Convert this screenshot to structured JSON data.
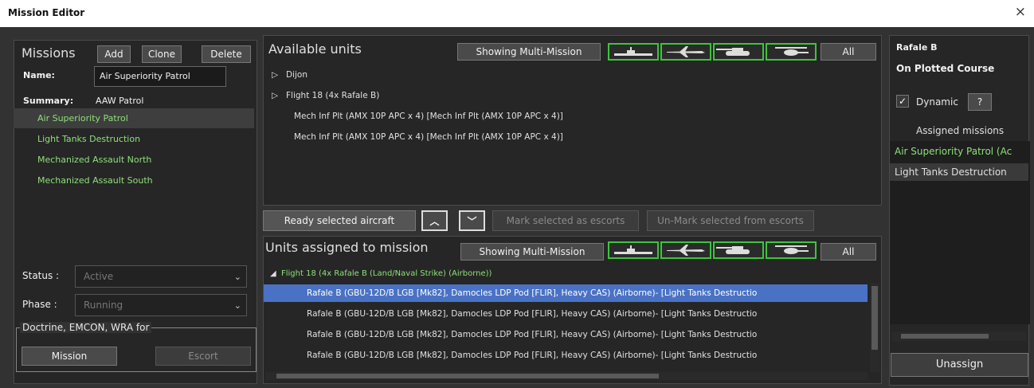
{
  "window": {
    "title": "Mission Editor",
    "close_glyph": "×"
  },
  "missions": {
    "header": "Missions",
    "add_label": "Add",
    "clone_label": "Clone",
    "delete_label": "Delete",
    "name_label": "Name:",
    "name_value": "Air Superiority Patrol",
    "summary_label": "Summary:",
    "summary_value": "AAW Patrol",
    "items": [
      {
        "label": "Air Superiority Patrol"
      },
      {
        "label": "Light Tanks Destruction"
      },
      {
        "label": "Mechanized Assault North"
      },
      {
        "label": "Mechanized Assault South"
      }
    ],
    "status_label": "Status :",
    "status_value": "Active",
    "phase_label": "Phase :",
    "phase_value": "Running",
    "doctrine_label": "Doctrine, EMCON, WRA for",
    "mission_btn": "Mission",
    "escort_btn": "Escort"
  },
  "available": {
    "header": "Available units",
    "filter_label": "Showing Multi-Mission",
    "all_label": "All",
    "rows": [
      {
        "expander": "▷",
        "text": "Dijon"
      },
      {
        "expander": "▷",
        "text": "Flight 18 (4x Rafale B)"
      },
      {
        "expander": "",
        "text": "Mech Inf Plt (AMX 10P APC x 4) [Mech Inf Plt (AMX 10P APC x 4)]"
      },
      {
        "expander": "",
        "text": "Mech Inf Plt (AMX 10P APC x 4) [Mech Inf Plt (AMX 10P APC x 4)]"
      }
    ],
    "icons": [
      "ship-icon",
      "aircraft-icon",
      "tank-icon",
      "helicopter-icon"
    ]
  },
  "middle": {
    "ready_label": "Ready selected aircraft",
    "up_glyph": "︿",
    "down_glyph": "﹀",
    "mark_escort_label": "Mark selected as escorts",
    "unmark_escort_label": "Un-Mark selected from escorts"
  },
  "assigned_units": {
    "header": "Units assigned to mission",
    "filter_label": "Showing Multi-Mission",
    "all_label": "All",
    "group_label": "Flight 18 (4x Rafale B (Land/Naval Strike) (Airborne))",
    "rows": [
      "Rafale B (GBU-12D/B LGB [Mk82], Damocles LDP Pod [FLIR], Heavy CAS) (Airborne)- [Light Tanks Destructio",
      "Rafale B (GBU-12D/B LGB [Mk82], Damocles LDP Pod [FLIR], Heavy CAS) (Airborne)- [Light Tanks Destructio",
      "Rafale B (GBU-12D/B LGB [Mk82], Damocles LDP Pod [FLIR], Heavy CAS) (Airborne)- [Light Tanks Destructio",
      "Rafale B (GBU-12D/B LGB [Mk82], Damocles LDP Pod [FLIR], Heavy CAS) (Airborne)- [Light Tanks Destructio"
    ]
  },
  "right": {
    "unit_name": "Rafale B",
    "course": "On Plotted Course",
    "dynamic_label": "Dynamic",
    "help_label": "?",
    "assigned_header": "Assigned missions",
    "missions": [
      "Air Superiority Patrol (Ac",
      "Light Tanks Destruction"
    ],
    "unassign_label": "Unassign"
  },
  "colors": {
    "accent_green": "#8fe07a",
    "selection_blue": "#4a72c4",
    "icon_border": "#3ec43e"
  }
}
